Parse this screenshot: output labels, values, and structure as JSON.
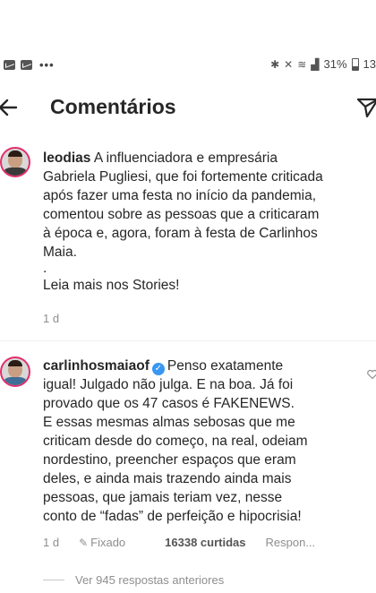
{
  "status_bar": {
    "battery": "31%",
    "time_partial": "13",
    "dots": "•••"
  },
  "header": {
    "title": "Comentários"
  },
  "comments": [
    {
      "username": "leodias",
      "lines": [
        "A influenciadora e empresária",
        "Gabriela Pugliesi, que foi fortemente criticada",
        "após fazer uma festa no início da pandemia,",
        "comentou sobre as pessoas que a criticaram",
        "à época e, agora, foram à festa de Carlinhos",
        "Maia.",
        ".",
        "Leia mais nos Stories!"
      ],
      "time": "1 d"
    },
    {
      "username": "carlinhosmaiaof",
      "verified": true,
      "lines": [
        "Penso exatamente",
        "igual! Julgado não julga.  E na boa. Já foi",
        "provado que os 47 casos é FAKENEWS.",
        "E essas mesmas almas sebosas que me",
        "criticam desde do começo, na real, odeiam",
        "nordestino, preencher espaços que eram",
        "deles, e ainda mais trazendo ainda mais",
        "pessoas, que jamais teriam vez, nesse",
        "conto de “fadas” de perfeição e hipocrisia!"
      ],
      "time": "1 d",
      "pinned": "Fixado",
      "likes": "16338 curtidas",
      "reply": "Respon..."
    }
  ],
  "more_replies": "Ver 945 respostas anteriores",
  "colors": {
    "story_ring": "#e1306c",
    "verified": "#3897f0",
    "meta_gray": "#8e8e8e"
  },
  "icons": [
    "back-arrow-icon",
    "send-icon",
    "verified-icon",
    "pin-icon",
    "heart-icon",
    "battery-icon",
    "wifi-icon",
    "signal-icon",
    "bluetooth-icon",
    "mute-icon"
  ]
}
